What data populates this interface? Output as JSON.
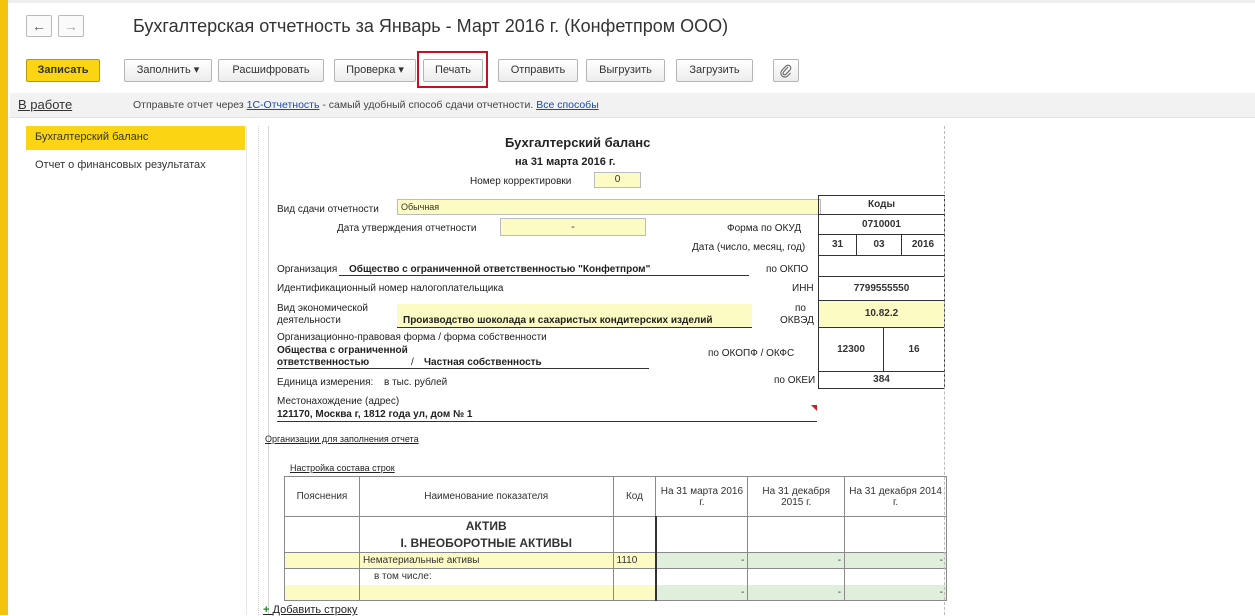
{
  "window": {
    "title": "Бухгалтерская отчетность за Январь - Март 2016 г. (Конфетпром ООО)",
    "back_icon": "arrow-left-icon",
    "forward_icon": "arrow-right-icon"
  },
  "toolbar": {
    "save": "Записать",
    "fill": "Заполнить",
    "decode": "Расшифровать",
    "check": "Проверка",
    "print": "Печать",
    "send": "Отправить",
    "export": "Выгрузить",
    "import": "Загрузить",
    "attach_icon": "paperclip-icon",
    "dropdown_glyph": "▾"
  },
  "status": {
    "state": "В работе",
    "msg_before": "Отправьте отчет через ",
    "msg_link": "1С-Отчетность",
    "msg_middle": " - самый удобный способ сдачи отчетности. ",
    "msg_link2": "Все способы"
  },
  "sidebar": {
    "items": [
      {
        "label": "Бухгалтерский баланс",
        "active": true
      },
      {
        "label": "Отчет о финансовых результатах",
        "active": false
      }
    ]
  },
  "form": {
    "title": "Бухгалтерский баланс",
    "date": "на 31 марта 2016 г.",
    "correction_label": "Номер корректировки",
    "correction_value": "0",
    "submission_label": "Вид сдачи отчетности",
    "submission_value": "Обычная",
    "approval_label": "Дата утверждения отчетности",
    "approval_value": "-",
    "codes_header": "Коды",
    "okud_label": "Форма по ОКУД",
    "okud_value": "0710001",
    "date_label": "Дата (число, месяц, год)",
    "date_day": "31",
    "date_month": "03",
    "date_year": "2016",
    "org_label": "Организация",
    "org_value": "Общество с ограниченной ответственностью \"Конфетпром\"",
    "okpo_label": "по ОКПО",
    "okpo_value": "",
    "inn_label": "Идентификационный номер налогоплательщика",
    "inn_short": "ИНН",
    "inn_value": "7799555550",
    "activity_label_1": "Вид экономической",
    "activity_label_2": "деятельности",
    "activity_value": "Производство шоколада и сахаристых кондитерских изделий",
    "okved_label_1": "по",
    "okved_label_2": "ОКВЭД",
    "okved_value": "10.82.2",
    "legal_form_label": "Организационно-правовая форма / форма собственности",
    "legal_form_value_1": "Общества с ограниченной",
    "legal_form_value_2": "ответственностью",
    "ownership_sep": "/",
    "ownership_value": "Частная собственность",
    "okopf_label": "по ОКОПФ / ОКФС",
    "okopf_value": "12300",
    "okfs_value": "16",
    "unit_label": "Единица измерения:",
    "unit_value": "в тыс. рублей",
    "okei_label": "по ОКЕИ",
    "okei_value": "384",
    "address_label": "Местонахождение (адрес)",
    "address_value": "121170, Москва г, 1812 года ул, дом № 1",
    "orgs_link": "Организации для заполнения отчета",
    "rows_link": "Настройка состава строк",
    "add_row": "Добавить строку"
  },
  "table": {
    "headers": [
      "Пояснения",
      "Наименование показателя",
      "Код",
      "На 31 марта 2016 г.",
      "На 31 декабря 2015 г.",
      "На 31 декабря 2014 г."
    ],
    "section": "АКТИВ",
    "subsection": "I. ВНЕОБОРОТНЫЕ АКТИВЫ",
    "rows": [
      {
        "name": "Нематериальные активы",
        "code": "1110",
        "v1": "-",
        "v2": "-",
        "v3": "-"
      },
      {
        "name": "в том числе:",
        "code": "",
        "v1": "-",
        "v2": "-",
        "v3": "-"
      }
    ]
  }
}
